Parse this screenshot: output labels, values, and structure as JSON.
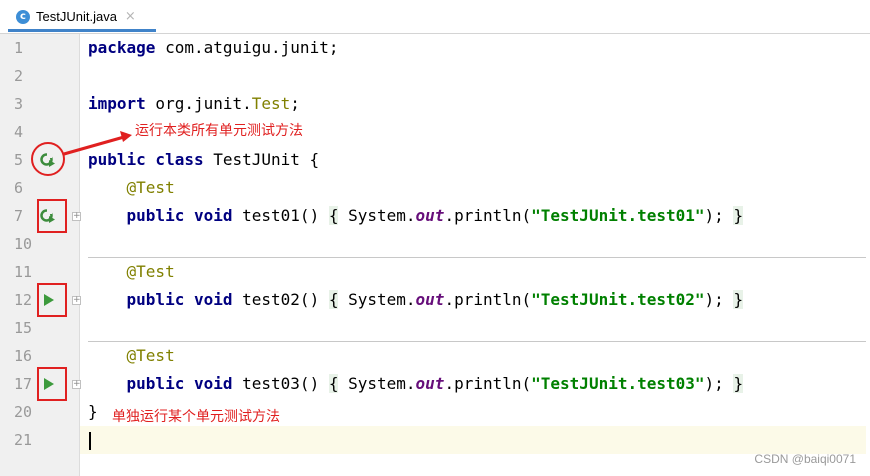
{
  "tab": {
    "icon_letter": "c",
    "title": "TestJUnit.java",
    "close": "×"
  },
  "lines": [
    {
      "no": "1",
      "code": "package com.atguigu.junit;"
    },
    {
      "no": "2",
      "code": ""
    },
    {
      "no": "3",
      "code": "import org.junit.Test;"
    },
    {
      "no": "4",
      "code": ""
    },
    {
      "no": "5",
      "code": "public class TestJUnit {"
    },
    {
      "no": "6",
      "code": "@Test"
    },
    {
      "no": "7",
      "code": "public void test01() { System.out.println(\"TestJUnit.test01\"); }"
    },
    {
      "no": "10",
      "code": ""
    },
    {
      "no": "11",
      "code": "@Test"
    },
    {
      "no": "12",
      "code": "public void test02() { System.out.println(\"TestJUnit.test02\"); }"
    },
    {
      "no": "15",
      "code": ""
    },
    {
      "no": "16",
      "code": "@Test"
    },
    {
      "no": "17",
      "code": "public void test03() { System.out.println(\"TestJUnit.test03\"); }"
    },
    {
      "no": "20",
      "code": "}"
    },
    {
      "no": "21",
      "code": ""
    }
  ],
  "annotations": {
    "run_all": "运行本类所有单元测试方法",
    "run_single": "单独运行某个单元测试方法"
  },
  "watermark": "CSDN @baiqi0071",
  "icons": {
    "run_class": "run-class-icon",
    "run_method": "run-method-icon",
    "fold": "fold-icon"
  },
  "colors": {
    "keyword": "#000080",
    "annotation": "#808000",
    "string": "#008000",
    "highlight": "#e02020"
  }
}
